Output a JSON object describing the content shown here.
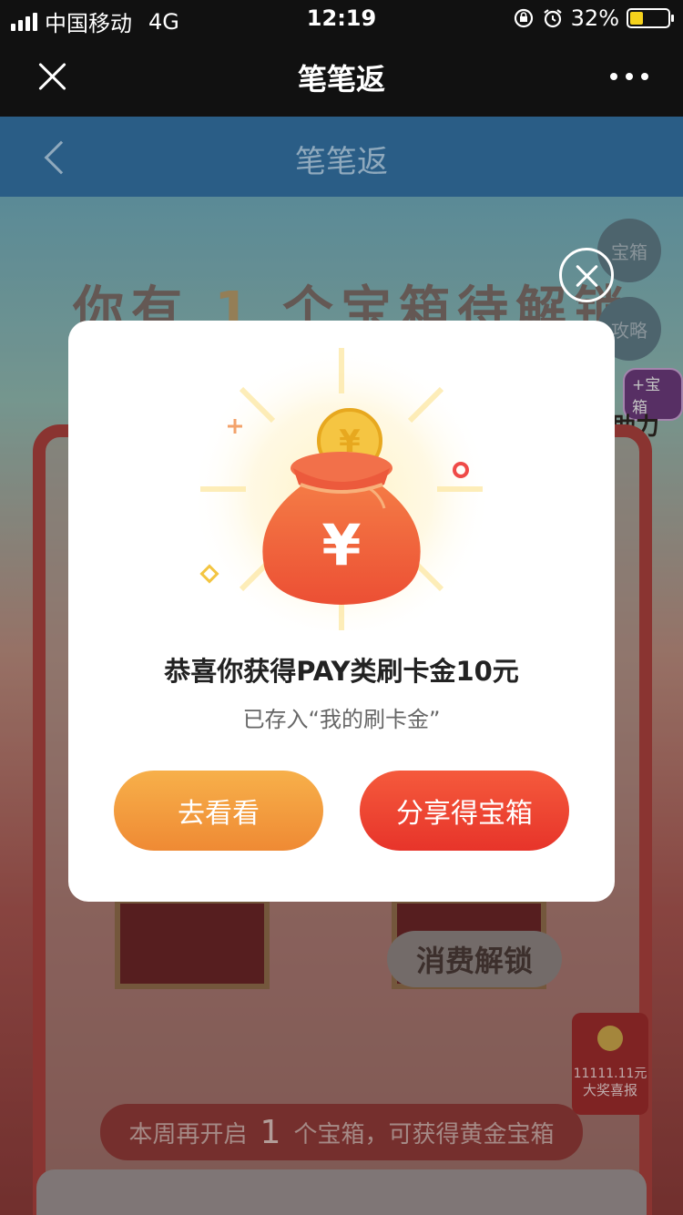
{
  "status_bar": {
    "carrier": "中国移动",
    "network": "4G",
    "time": "12:19",
    "battery_percent": "32%",
    "battery_level": 0.32,
    "icons": [
      "signal-icon",
      "rotation-lock-icon",
      "alarm-icon",
      "battery-icon"
    ]
  },
  "app_header": {
    "title": "笔笔返",
    "close_icon": "close-icon",
    "more_icon": "more-dots-icon"
  },
  "page_nav": {
    "title": "笔笔返",
    "back_icon": "chevron-left-icon"
  },
  "background": {
    "headline_prefix": "你有",
    "headline_count": "1",
    "headline_suffix": "个宝箱待解锁",
    "side_chest": "宝箱",
    "side_guide": "攻略",
    "assist_tag": "+宝箱",
    "assist_label": "助力",
    "unlock_button": "消费解锁",
    "weekly_prefix": "本周再开启",
    "weekly_count": "1",
    "weekly_suffix": "个宝箱，可获得黄金宝箱",
    "prize_amount": "11111.11元",
    "prize_label": "大奖喜报"
  },
  "modal": {
    "message": "恭喜你获得PAY类刷卡金10元",
    "sub_message": "已存入“我的刷卡金”",
    "view_button": "去看看",
    "share_button": "分享得宝箱",
    "close_icon": "circle-close-icon",
    "illustration": "money-bag-icon",
    "colors": {
      "view_button": "#f0953a",
      "share_button": "#ea3d2e",
      "bag": "#f06a3c",
      "coin": "#f5c542"
    }
  }
}
